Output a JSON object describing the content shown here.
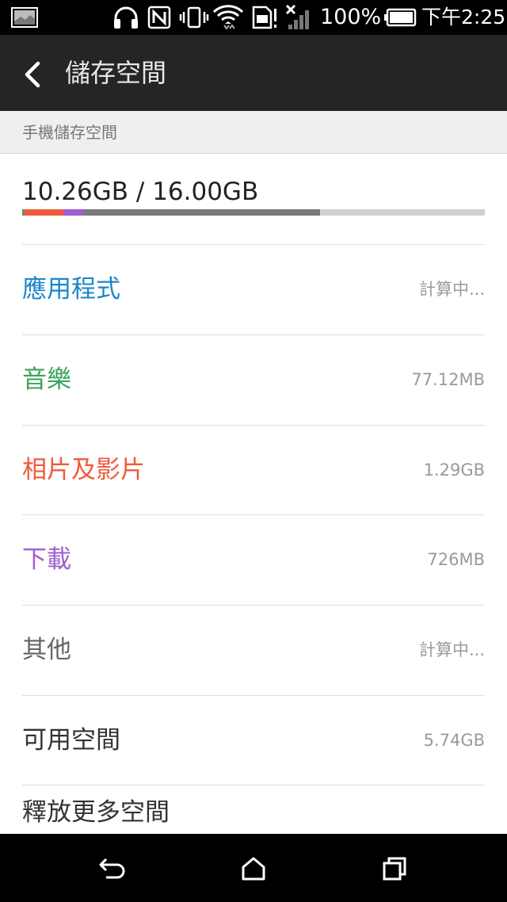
{
  "status_bar": {
    "battery_percent": "100%",
    "time": "下午2:25"
  },
  "app_bar": {
    "title": "儲存空間"
  },
  "section": {
    "title": "手機儲存空間"
  },
  "usage": {
    "text": "10.26GB / 16.00GB",
    "segments": [
      {
        "name": "apps",
        "color": "#3aa35a",
        "fraction": 0.003
      },
      {
        "name": "photos-videos",
        "color": "#f05a3c",
        "fraction": 0.085
      },
      {
        "name": "downloads",
        "color": "#a060d0",
        "fraction": 0.045
      },
      {
        "name": "other",
        "color": "#7a7a7a",
        "fraction": 0.51
      }
    ]
  },
  "rows": [
    {
      "key": "apps",
      "label": "應用程式",
      "value": "計算中...",
      "color": "#1a86c8"
    },
    {
      "key": "music",
      "label": "音樂",
      "value": "77.12MB",
      "color": "#3aa35a"
    },
    {
      "key": "photos-videos",
      "label": "相片及影片",
      "value": "1.29GB",
      "color": "#f05a3c"
    },
    {
      "key": "downloads",
      "label": "下載",
      "value": "726MB",
      "color": "#a060d0"
    },
    {
      "key": "other",
      "label": "其他",
      "value": "計算中...",
      "color": "#666666"
    },
    {
      "key": "available",
      "label": "可用空間",
      "value": "5.74GB",
      "color": "#333333"
    },
    {
      "key": "free-up",
      "label": "釋放更多空間",
      "value": "",
      "color": "#333333"
    }
  ]
}
